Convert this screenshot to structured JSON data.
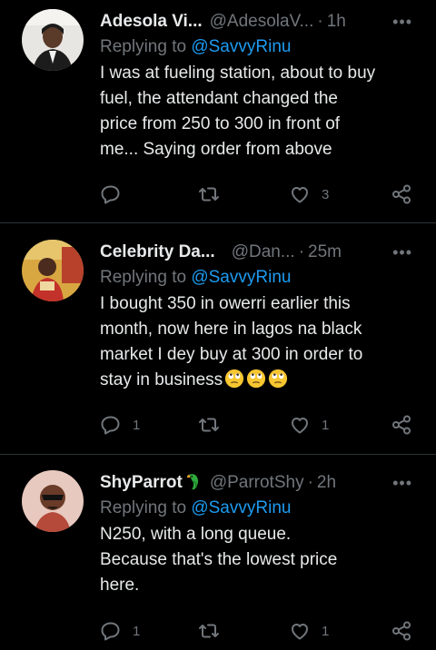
{
  "tweets": [
    {
      "name": "Adesola Vi...",
      "handle": "@AdesolaV...",
      "time": "1h",
      "replying_prefix": "Replying to",
      "replying_to": "@SavvyRinu",
      "text": "I was at fueling station, about to buy\nfuel, the attendant changed the\nprice from 250  to 300 in front of\nme... Saying order from above",
      "reply_count": "",
      "retweet_count": "",
      "like_count": "3"
    },
    {
      "name": "Celebrity Da...",
      "handle": "@Dan...",
      "time": "25m",
      "replying_prefix": "Replying to",
      "replying_to": "@SavvyRinu",
      "text": "I bought 350 in owerri earlier this\nmonth, now here in lagos na black\nmarket I dey buy at 300 in order to\nstay in business",
      "emojis": [
        "face-with-rolling-eyes-icon",
        "face-with-rolling-eyes-icon",
        "face-with-rolling-eyes-icon"
      ],
      "reply_count": "1",
      "retweet_count": "",
      "like_count": "1"
    },
    {
      "name": "ShyParrot",
      "name_emoji": "parrot-icon",
      "handle": "@ParrotShy",
      "time": "2h",
      "replying_prefix": "Replying to",
      "replying_to": "@SavvyRinu",
      "text": "N250, with a long queue.\nBecause that's the lowest price\nhere.",
      "reply_count": "1",
      "retweet_count": "",
      "like_count": "1"
    }
  ],
  "separator": "·",
  "colors": {
    "background": "#000000",
    "text": "#e7e9ea",
    "muted": "#71767b",
    "accent": "#1d9bf0",
    "divider": "#2f3336"
  }
}
